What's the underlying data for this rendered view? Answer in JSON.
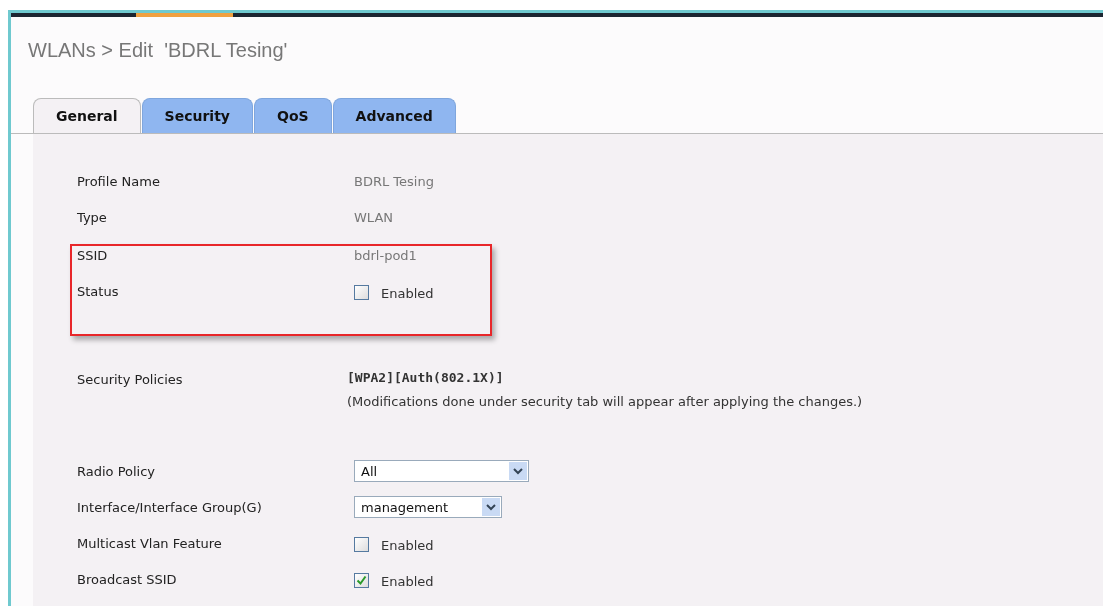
{
  "page": {
    "title": "WLANs > Edit  'BDRL Tesing'"
  },
  "tabs": [
    {
      "label": "General",
      "selected": true
    },
    {
      "label": "Security",
      "selected": false
    },
    {
      "label": "QoS",
      "selected": false
    },
    {
      "label": "Advanced",
      "selected": false
    }
  ],
  "groups": [
    {
      "rows": [
        {
          "kind": "text",
          "label": "Profile Name",
          "value": "BDRL Tesing"
        },
        {
          "kind": "text",
          "label": "Type",
          "value": "WLAN"
        }
      ]
    },
    {
      "highlighted": true,
      "rows": [
        {
          "kind": "text",
          "label": "SSID",
          "value": "bdrl-pod1"
        },
        {
          "kind": "checkbox",
          "label": "Status",
          "value": "Enabled",
          "checked": false
        }
      ]
    },
    {
      "rows": [
        {
          "kind": "policy",
          "label": "Security Policies",
          "value": "[WPA2][Auth(802.1X)]",
          "note": "(Modifications done under security tab will appear after applying the changes.)"
        }
      ]
    },
    {
      "rows": [
        {
          "kind": "select",
          "label": "Radio Policy",
          "value": "All"
        },
        {
          "kind": "select",
          "label": "Interface/Interface Group(G)",
          "value": "management"
        },
        {
          "kind": "checkbox",
          "label": "Multicast Vlan Feature",
          "value": "Enabled",
          "checked": false
        },
        {
          "kind": "checkbox",
          "label": "Broadcast SSID",
          "value": "Enabled",
          "checked": true
        }
      ]
    }
  ]
}
